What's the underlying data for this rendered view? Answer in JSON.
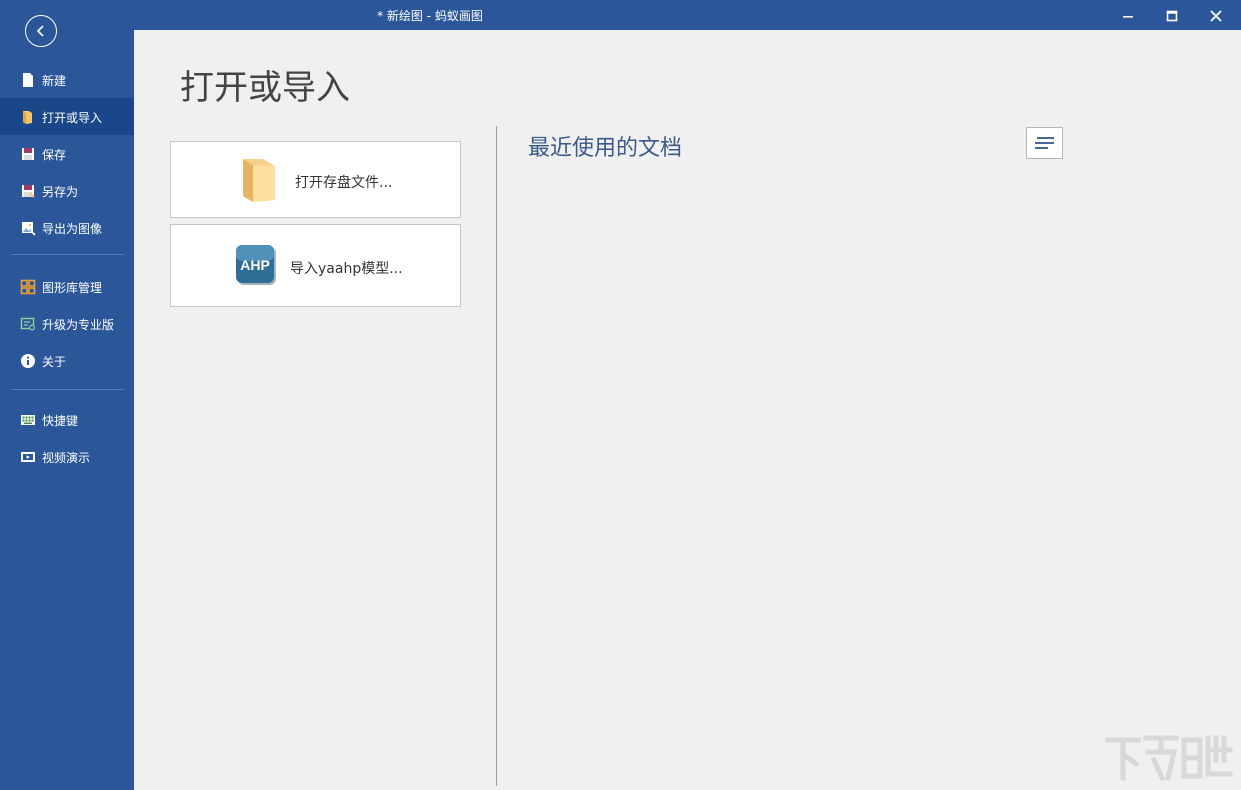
{
  "window": {
    "title": "* 新绘图 - 蚂蚁画图"
  },
  "sidebar": {
    "items": [
      {
        "label": "新建",
        "icon": "new-file-icon"
      },
      {
        "label": "打开或导入",
        "icon": "open-file-icon",
        "active": true
      },
      {
        "label": "保存",
        "icon": "save-icon"
      },
      {
        "label": "另存为",
        "icon": "save-as-icon"
      },
      {
        "label": "导出为图像",
        "icon": "export-image-icon"
      },
      {
        "label": "图形库管理",
        "icon": "library-icon"
      },
      {
        "label": "升级为专业版",
        "icon": "upgrade-icon"
      },
      {
        "label": "关于",
        "icon": "info-icon"
      },
      {
        "label": "快捷键",
        "icon": "keyboard-icon"
      },
      {
        "label": "视频演示",
        "icon": "video-icon"
      }
    ]
  },
  "main": {
    "title": "打开或导入",
    "actions": {
      "open_label": "打开存盘文件...",
      "open_icon": "folder-icon",
      "import_label": "导入yaahp模型...",
      "import_icon": "ahp-logo-icon",
      "import_icon_text": "AHP"
    },
    "recent": {
      "title": "最近使用的文档",
      "view_icon": "list-view-icon"
    }
  },
  "colors": {
    "sidebar_bg": "#2b579a",
    "sidebar_active": "#19478a",
    "content_bg": "#f0f0f0",
    "recent_title": "#3b5a8a"
  }
}
